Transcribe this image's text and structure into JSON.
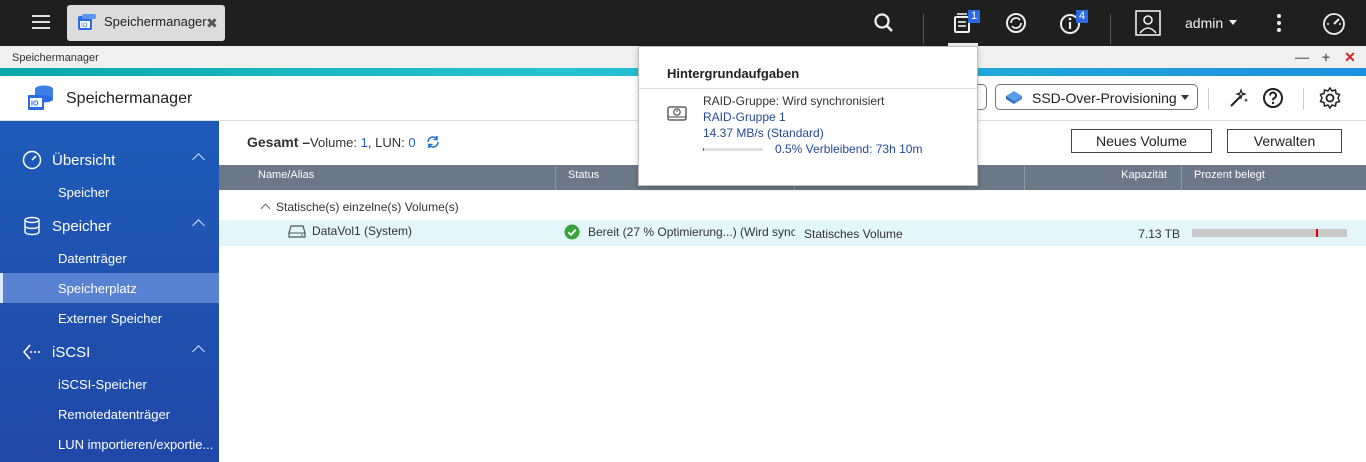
{
  "topbar": {
    "app_tab_label": "Speichermanager",
    "tasks_badge": "1",
    "notifications_badge": "4",
    "user": "admin"
  },
  "window": {
    "title": "Speichermanager"
  },
  "header": {
    "app_name": "Speichermanager",
    "ssd_button": "SSD-Over-Provisioning"
  },
  "sidebar": {
    "sections": [
      {
        "label": "Übersicht",
        "items": [
          "Speicher"
        ]
      },
      {
        "label": "Speicher",
        "items": [
          "Datenträger",
          "Speicherplatz",
          "Externer Speicher"
        ]
      },
      {
        "label": "iSCSI",
        "items": [
          "iSCSI-Speicher",
          "Remotedatenträger",
          "LUN importieren/exportie..."
        ]
      }
    ],
    "active_item": "Speicherplatz"
  },
  "summary": {
    "label": "Gesamt –",
    "volume_label": "Volume:",
    "volume_count": "1",
    "sep": ", LUN:",
    "lun_count": "0"
  },
  "actions": {
    "new_volume": "Neues Volume",
    "manage": "Verwalten"
  },
  "table": {
    "headers": [
      "Name/Alias",
      "Status",
      "",
      "Kapazität",
      "Prozent belegt"
    ],
    "group_label": "Statische(s) einzelne(s) Volume(s)",
    "rows": [
      {
        "name": "DataVol1 (System)",
        "status": "Bereit (27 % Optimierung...) (Wird sync",
        "type": "Statisches Volume",
        "capacity": "7.13 TB",
        "used_fraction": 0.8
      }
    ]
  },
  "popover": {
    "title": "Hintergrundaufgaben",
    "task_line1": "RAID-Gruppe: Wird synchronisiert",
    "task_line2": "RAID-Gruppe 1",
    "task_line3": "14.37 MB/s (Standard)",
    "task_progress_text": "0.5%  Verbleibend: 73h 10m",
    "task_progress": 0.005
  }
}
